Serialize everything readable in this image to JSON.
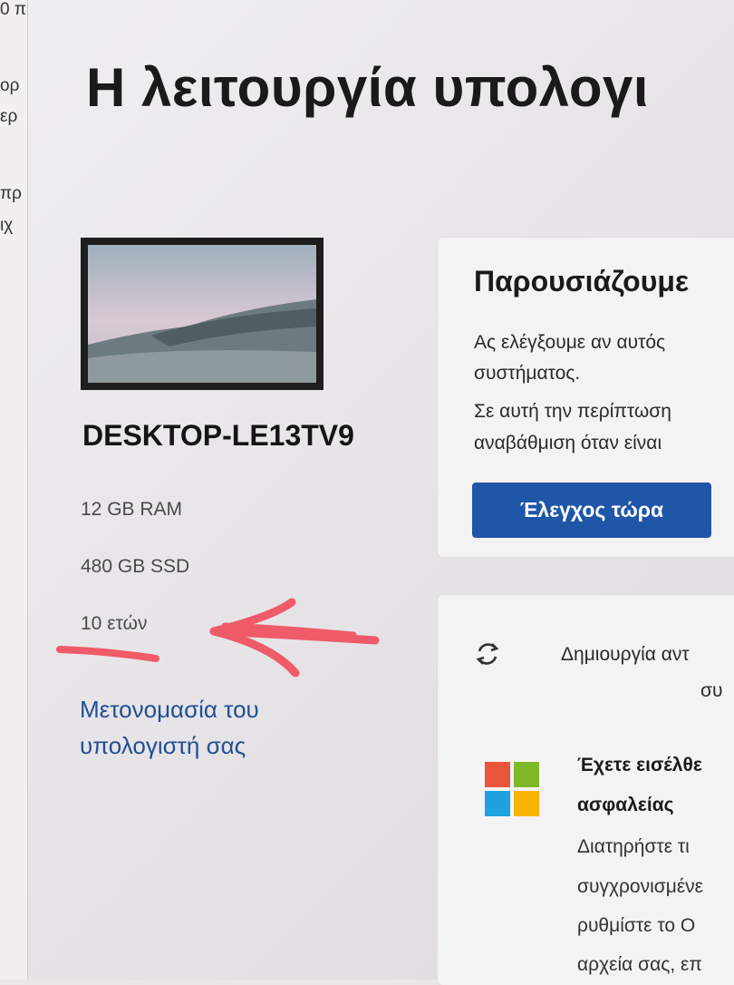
{
  "left_edge": {
    "fragments": [
      "0 π",
      "ορ",
      "ερ",
      "πρ",
      "ιχ"
    ]
  },
  "header": {
    "title": "Η λειτουργία υπολογι"
  },
  "device": {
    "name": "DESKTOP-LE13TV9",
    "specs": [
      "12 GB RAM",
      "480 GB SSD",
      "10 ετών"
    ],
    "rename_link": [
      "Μετονομασία του",
      "υπολογιστή σας"
    ]
  },
  "card_intro": {
    "title": "Παρουσιάζουμε",
    "lines": [
      "Ας ελέγξουμε αν αυτός",
      "συστήματος.",
      "Σε αυτή την περίπτωση",
      "αναβάθμιση όταν είναι"
    ],
    "button": "Έλεγχος τώρα"
  },
  "card_backup": {
    "header_lines": [
      "Δημιουργία αντ",
      "συ"
    ],
    "bold_lines": [
      "Έχετε εισέλθε",
      "ασφαλείας"
    ],
    "body_lines": [
      "Διατηρήστε τι",
      "συγχρονισμένε",
      "ρυθμίστε το Ο",
      "αρχεία σας, επ"
    ]
  },
  "colors": {
    "accent_button": "#1f56a8",
    "link": "#1f4f94",
    "annotation": "#ef5b68",
    "ms_red": "#e9553c",
    "ms_green": "#7fb826",
    "ms_blue": "#1ea2e0",
    "ms_yellow": "#f7b300"
  },
  "icons": {
    "sync": "sync-icon",
    "ms_logo": "microsoft-logo-icon",
    "annotation": "red-arrow-annotation"
  }
}
